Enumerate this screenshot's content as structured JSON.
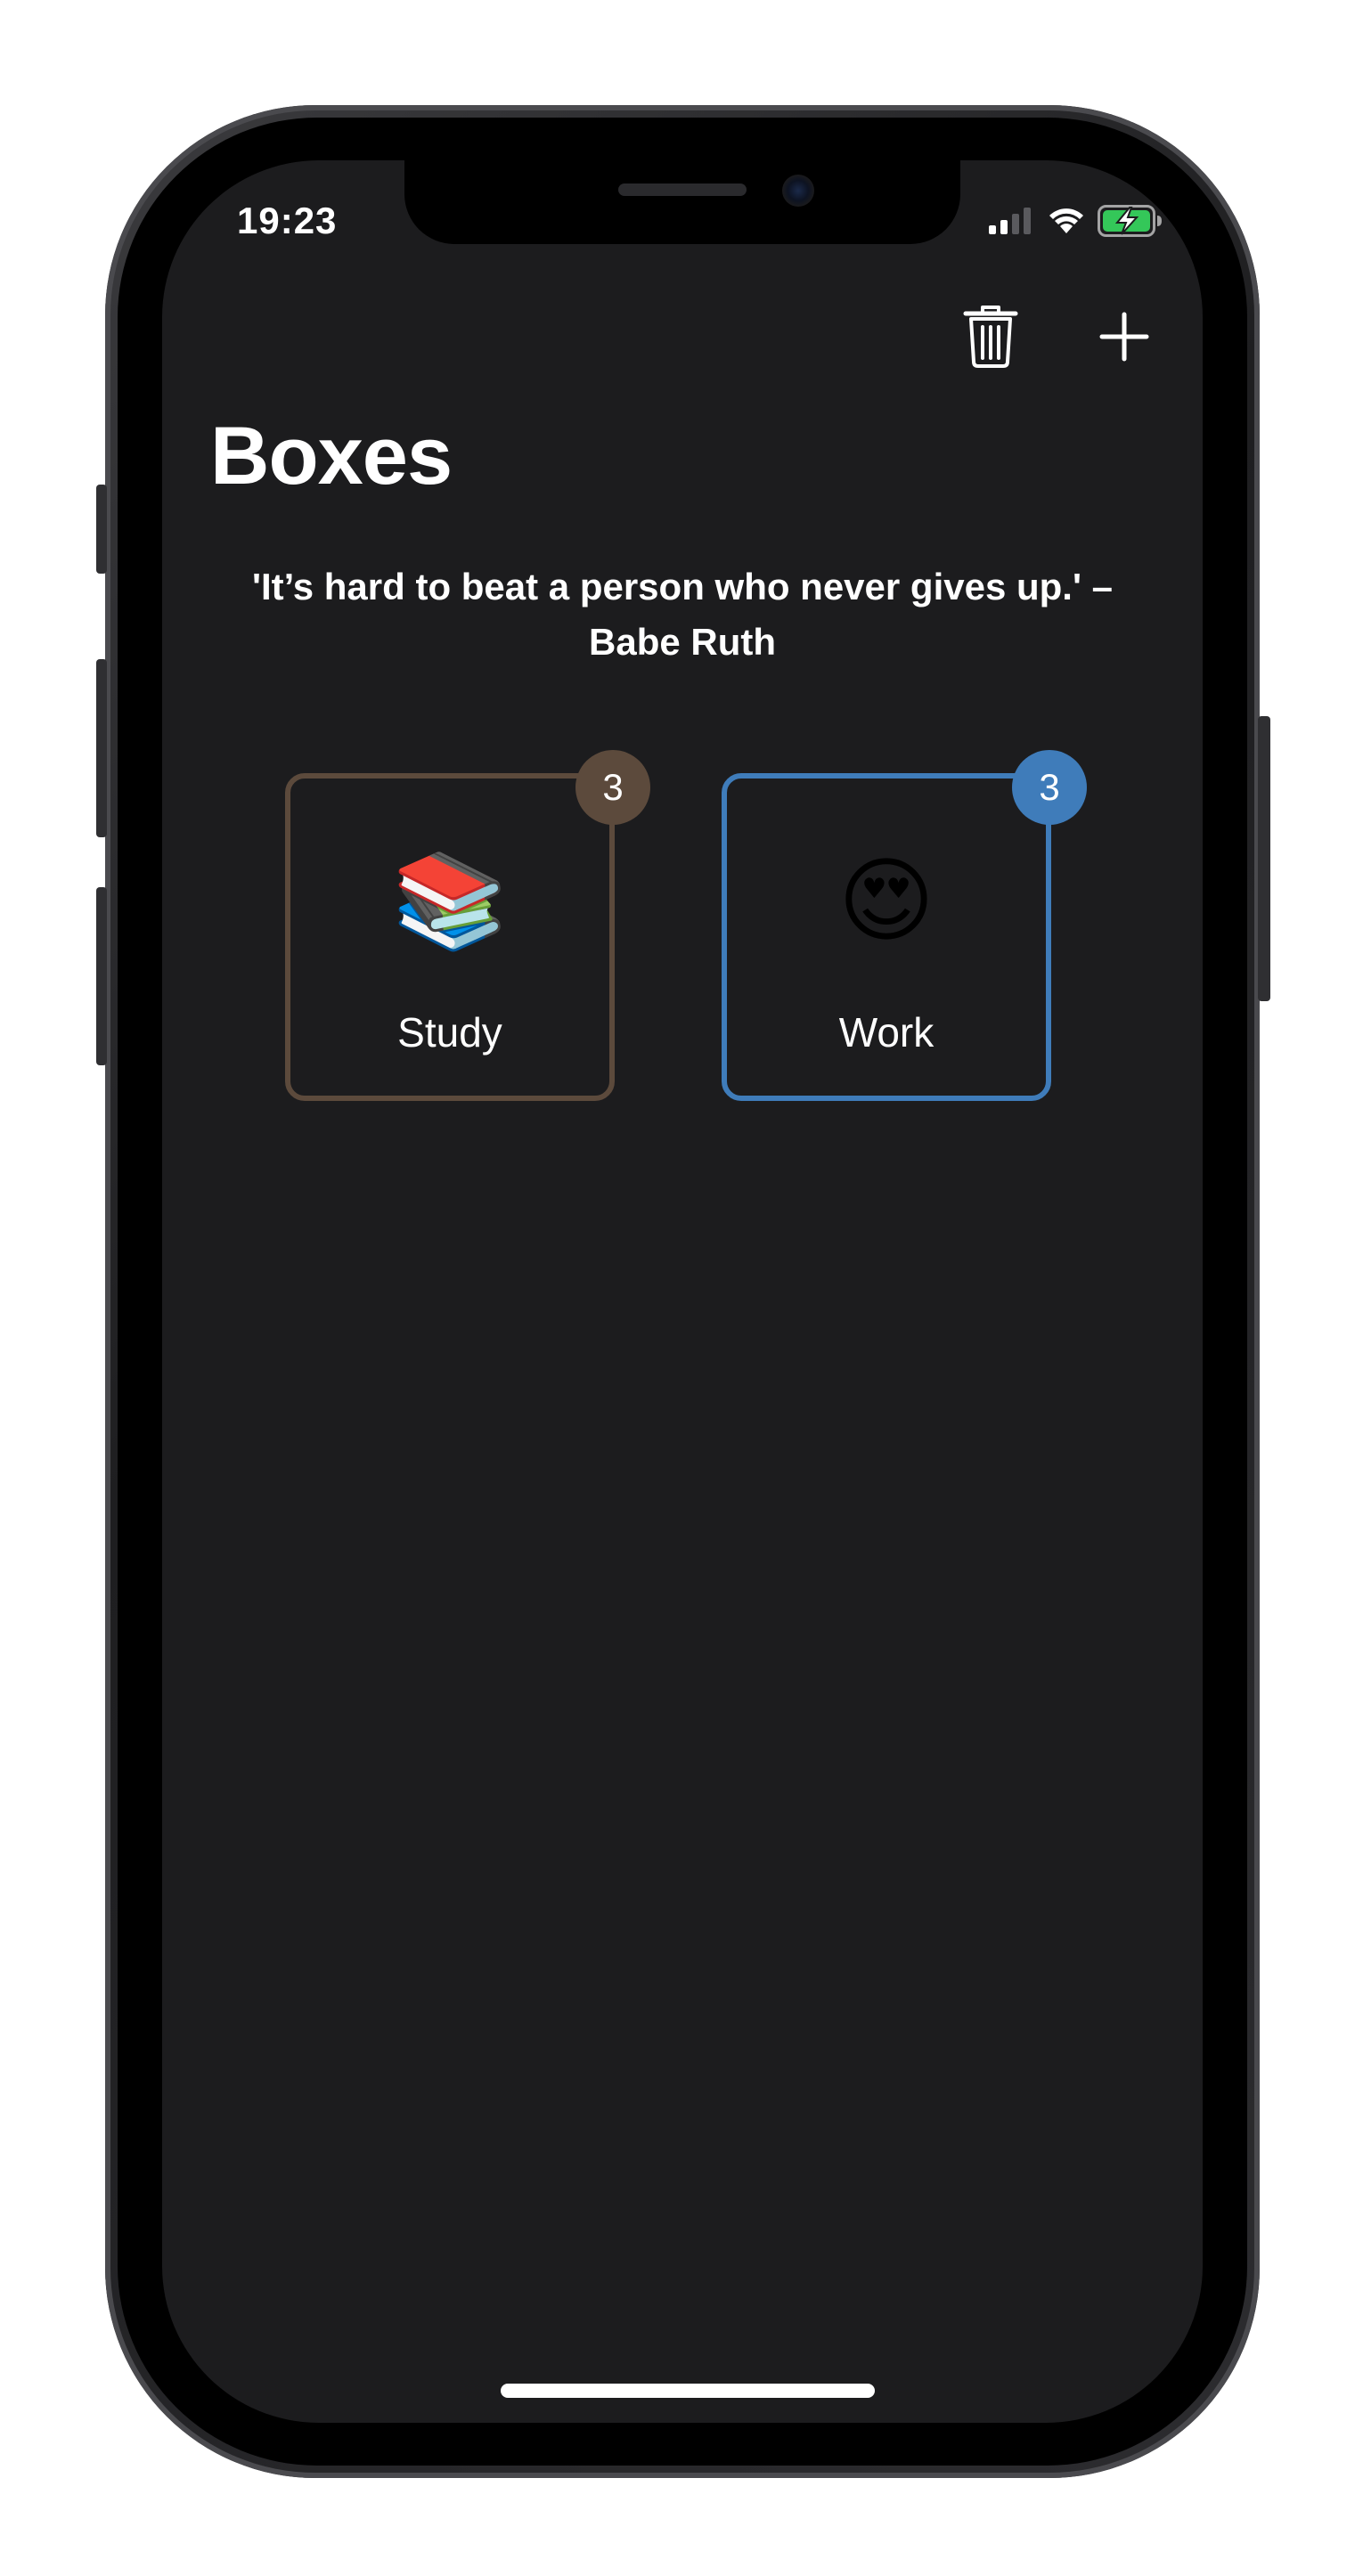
{
  "status_bar": {
    "time": "19:23",
    "icons": [
      "cellular-signal-icon",
      "wifi-icon",
      "battery-charging-icon"
    ],
    "battery_color": "#34c759"
  },
  "toolbar": {
    "delete_icon": "trash-icon",
    "add_icon": "plus-icon"
  },
  "header": {
    "title": "Boxes"
  },
  "quote": {
    "text": "'It’s hard to beat a person who never gives up.' – Babe Ruth"
  },
  "boxes": [
    {
      "emoji": "📚",
      "label": "Study",
      "count": "3",
      "color": "#5c4a3c"
    },
    {
      "emoji": "😍",
      "label": "Work",
      "count": "3",
      "color": "#3f7cba"
    }
  ],
  "theme": {
    "background": "#1c1c1e",
    "text": "#ffffff"
  }
}
